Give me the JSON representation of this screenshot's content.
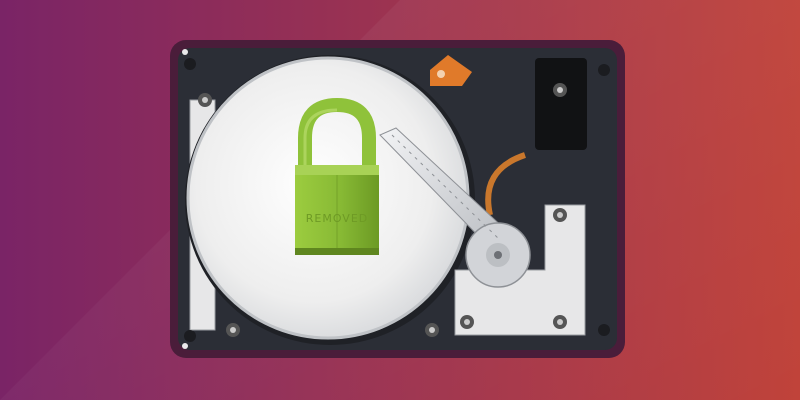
{
  "colors": {
    "background_left": "#7a2466",
    "background_right": "#c0433a",
    "drive_frame": "#4a1d3a",
    "drive_case": "#2b2e36",
    "platter_light": "#f4f4f4",
    "platter_shadow": "#c9cbcf",
    "padlock_green": "#8fc23a",
    "padlock_dark": "#6e9a25",
    "actuator_silver": "#d8dadd",
    "copper_accent": "#e07a2a"
  },
  "icons": {
    "main": "hard-drive-icon",
    "lock": "padlock-icon"
  },
  "padlock": {
    "engraving": "REMOVED"
  }
}
